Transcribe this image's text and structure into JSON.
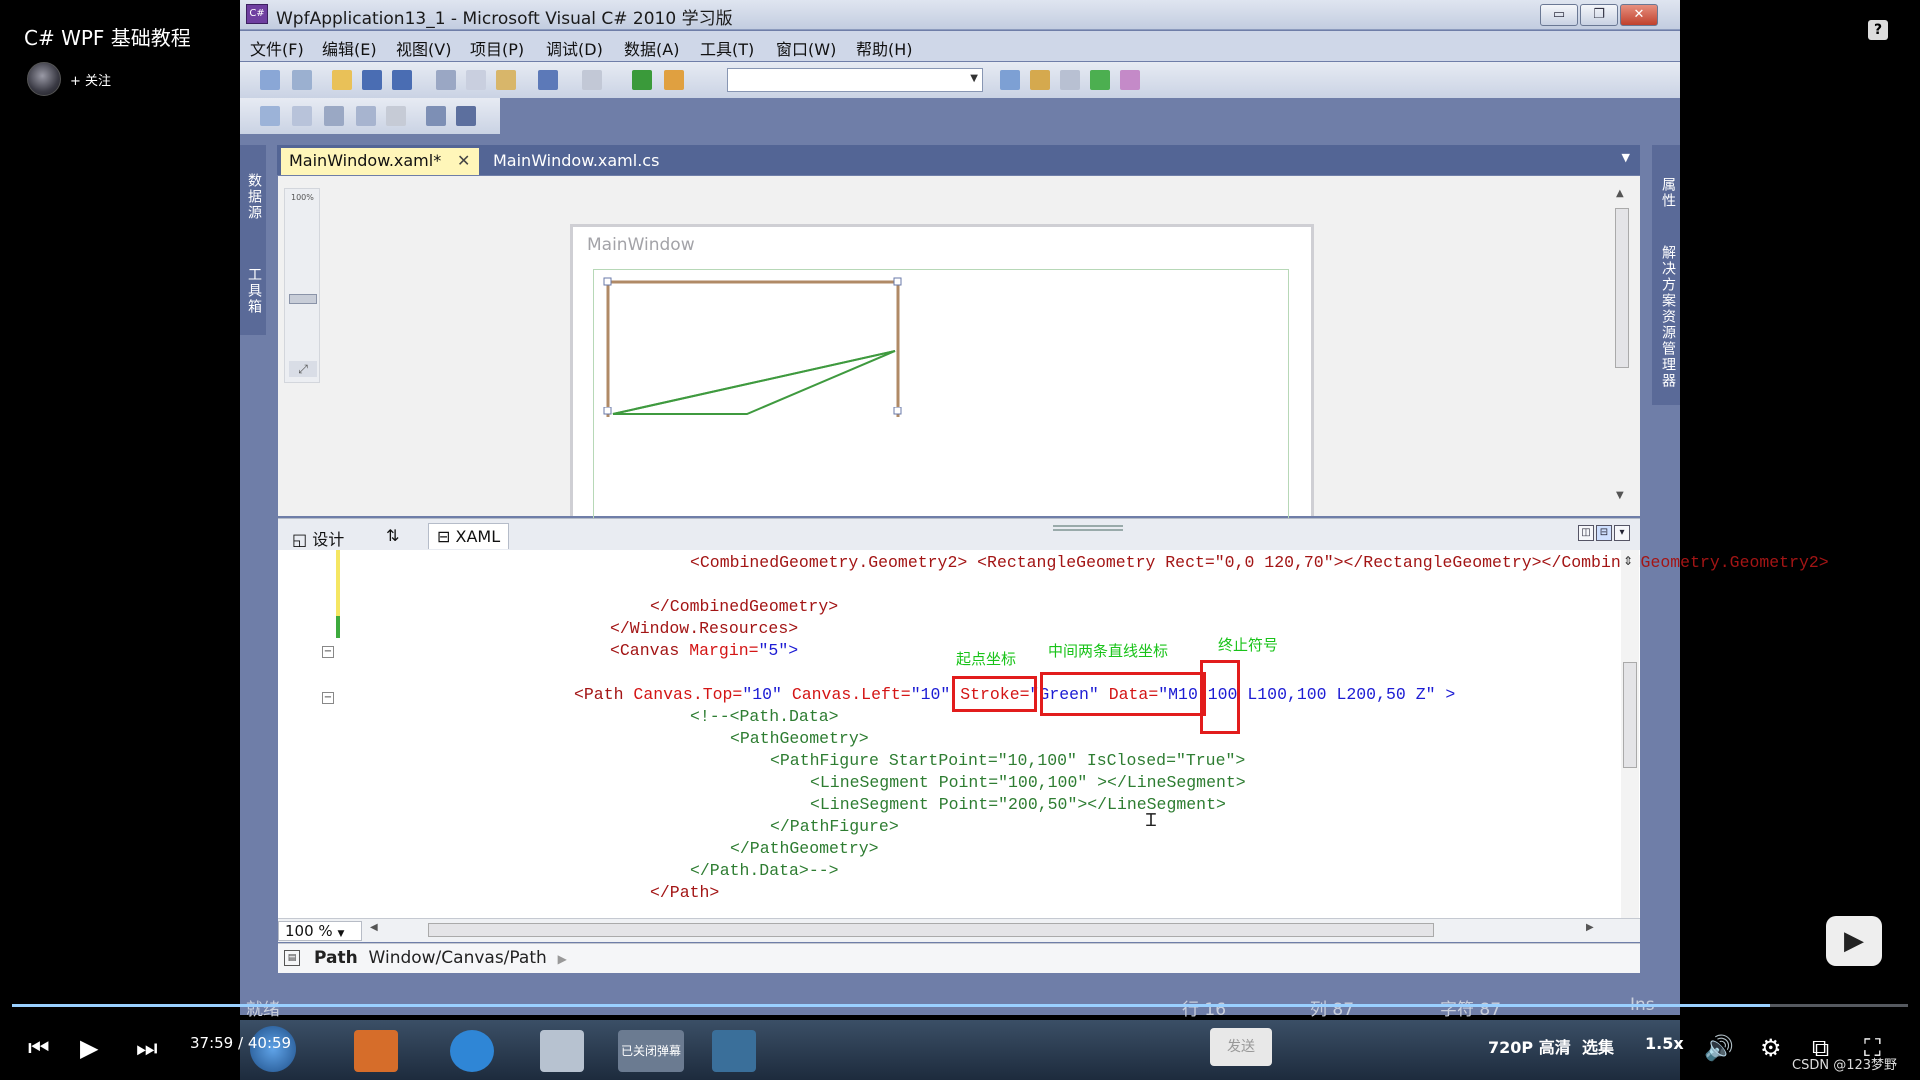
{
  "video": {
    "title": "C# WPF 基础教程",
    "follow_label": "+ 关注",
    "time_current": "37:59",
    "time_separator": "/",
    "time_total": "40:59",
    "progress_fraction": 0.927,
    "send_label": "发送",
    "quality_label": "720P 高清",
    "episodes_label": "选集",
    "speed_label": "1.5x",
    "watermark": "CSDN @123梦野",
    "help_label": "?"
  },
  "window": {
    "title": "WpfApplication13_1 - Microsoft Visual C# 2010 学习版",
    "minimize_glyph": "▭",
    "restore_glyph": "❐",
    "close_glyph": "✕"
  },
  "menu": [
    "文件(F)",
    "编辑(E)",
    "视图(V)",
    "项目(P)",
    "调试(D)",
    "数据(A)",
    "工具(T)",
    "窗口(W)",
    "帮助(H)"
  ],
  "side_panels": {
    "left": [
      "数据源",
      "工具箱"
    ],
    "right": [
      "属性",
      "解决方案资源管理器"
    ]
  },
  "doc_tabs": [
    {
      "label": "MainWindow.xaml*",
      "active": true
    },
    {
      "label": "MainWindow.xaml.cs",
      "active": false
    }
  ],
  "designer": {
    "zoom_label": "100%",
    "window_title": "MainWindow"
  },
  "view_tabs": {
    "design": "设计",
    "swap": "⇅",
    "xaml": "XAML"
  },
  "code": {
    "line1_prefix": "<CombinedGeometry.Geometry2> <RectangleGeometry Rect=\"0,0 120,70\"></RectangleGeometry></CombinedGeometry.Geometry2>",
    "line3": "</CombinedGeometry>",
    "line4": "</Window.Resources>",
    "line5_tag": "<Canvas",
    "line5_attr": " Margin=",
    "line5_val": "\"5\"",
    "line5_end": ">",
    "line7_tag": "<Path",
    "line7_a1": " Canvas.Top=",
    "line7_v1": "\"10\"",
    "line7_a2": " Canvas.Left=",
    "line7_v2": "\"10\"",
    "line7_a3": " Stroke=",
    "line7_v3": "\"Green\"",
    "line7_a4": " Data=",
    "line7_v4": "\"M10,100 L100,100 L200,50 Z\"",
    "line7_end": " >",
    "line8": "<!--<Path.Data>",
    "line9": "<PathGeometry>",
    "line10": "<PathFigure StartPoint=\"10,100\" IsClosed=\"True\">",
    "line11": "<LineSegment Point=\"100,100\" ></LineSegment>",
    "line12": "<LineSegment Point=\"200,50\"></LineSegment>",
    "line13": "</PathFigure>",
    "line14": "</PathGeometry>",
    "line15": "</Path.Data>-->",
    "line16": "</Path>"
  },
  "annotations": {
    "start": "起点坐标",
    "middle": "中间两条直线坐标",
    "end": "终止符号"
  },
  "editor_bottom": {
    "zoom": "100 %",
    "breadcrumb_bold": "Path",
    "breadcrumb_path": "Window/Canvas/Path"
  },
  "status": {
    "ready": "就绪",
    "line": "行 16",
    "col": "列 87",
    "char": "字符 87",
    "ins": "Ins"
  },
  "taskbar": {
    "pinned_label": "已关闭弹幕"
  },
  "colors": {
    "path_stroke": "#3f9a3f",
    "selection_border": "#b08a66",
    "annotation_box": "#e21c1c",
    "annotation_text": "#19c319"
  }
}
